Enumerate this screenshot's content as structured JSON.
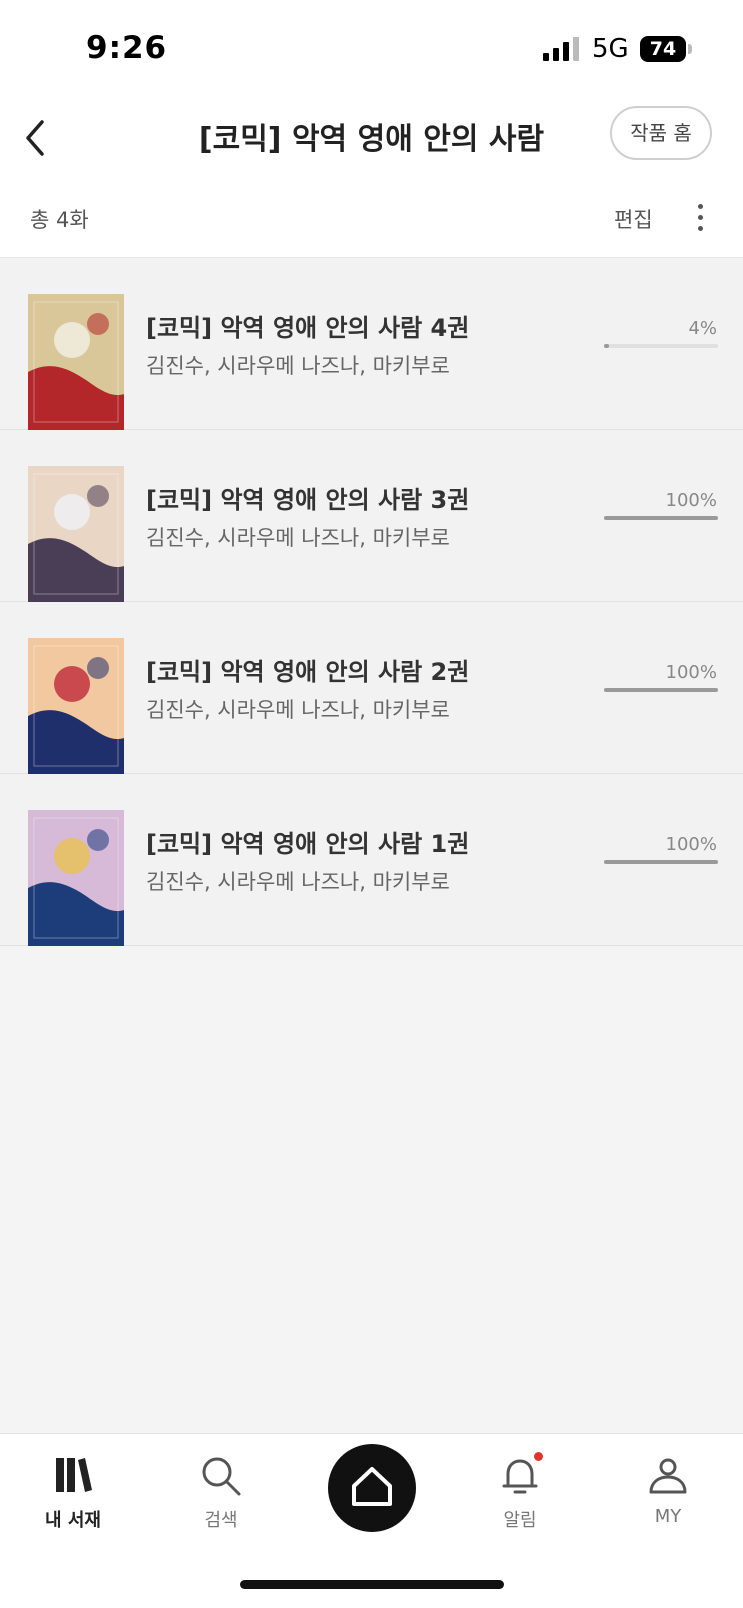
{
  "status_bar": {
    "time": "9:26",
    "network": "5G",
    "battery": "74"
  },
  "header": {
    "title": "[코믹] 악역 영애 안의 사람",
    "home_button": "작품 홈"
  },
  "subbar": {
    "total": "총 4화",
    "edit": "편집"
  },
  "items": [
    {
      "title": "[코믹] 악역 영애 안의 사람 4권",
      "author": "김진수, 시라우메 나즈나, 마키부로",
      "progress_label": "4%",
      "progress": 0.04,
      "cover_colors": [
        "#d9c79a",
        "#b3262a",
        "#f1ede2"
      ]
    },
    {
      "title": "[코믹] 악역 영애 안의 사람 3권",
      "author": "김진수, 시라우메 나즈나, 마키부로",
      "progress_label": "100%",
      "progress": 1.0,
      "cover_colors": [
        "#e9d6c4",
        "#4a3e57",
        "#eef0f3"
      ]
    },
    {
      "title": "[코믹] 악역 영애 안의 사람 2권",
      "author": "김진수, 시라우메 나즈나, 마키부로",
      "progress_label": "100%",
      "progress": 1.0,
      "cover_colors": [
        "#f2c8a0",
        "#1f2f6b",
        "#c23341"
      ]
    },
    {
      "title": "[코믹] 악역 영애 안의 사람 1권",
      "author": "김진수, 시라우메 나즈나, 마키부로",
      "progress_label": "100%",
      "progress": 1.0,
      "cover_colors": [
        "#d7b9d8",
        "#1c3c7a",
        "#e8c25a"
      ]
    }
  ],
  "tabbar": {
    "library": "내 서재",
    "search": "검색",
    "alerts": "알림",
    "my": "MY"
  },
  "icons": {
    "back": "chevron-left-icon",
    "more": "more-vertical-icon",
    "library": "library-books-icon",
    "search": "search-icon",
    "home": "home-icon",
    "alerts": "bell-icon",
    "my": "person-icon"
  },
  "colors": {
    "accent": "#111111",
    "notification": "#e0352b",
    "progress": "#9a9a9a"
  }
}
